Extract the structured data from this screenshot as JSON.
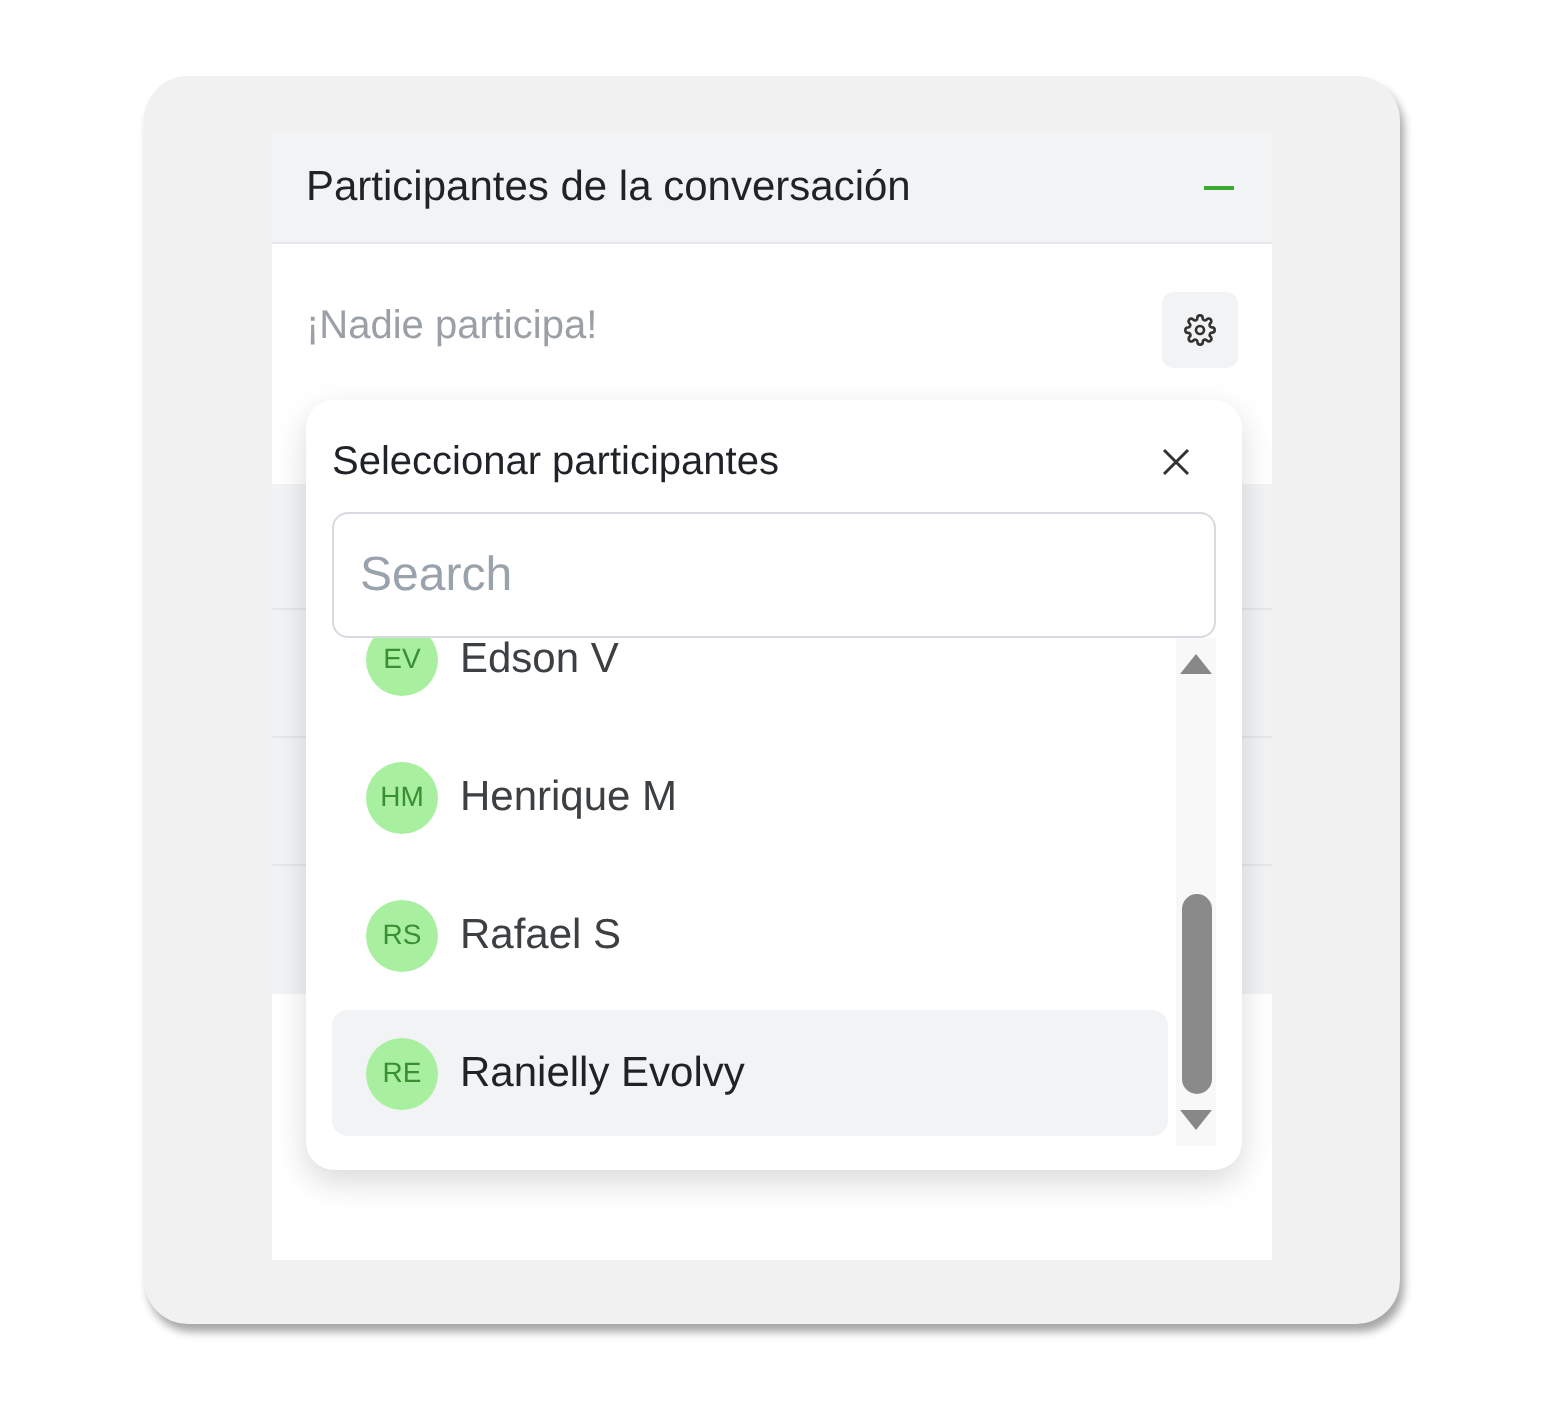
{
  "panel": {
    "title": "Participantes de la conversación",
    "expanded": true,
    "empty_text": "¡Nadie participa!"
  },
  "popover": {
    "title": "Seleccionar participantes",
    "search": {
      "placeholder": "Search"
    },
    "items": [
      {
        "initials": "EV",
        "name": "Edson V",
        "selected": false
      },
      {
        "initials": "HM",
        "name": "Henrique M",
        "selected": false
      },
      {
        "initials": "RS",
        "name": "Rafael S",
        "selected": false
      },
      {
        "initials": "RE",
        "name": "Ranielly Evolvy",
        "selected": true
      }
    ]
  }
}
